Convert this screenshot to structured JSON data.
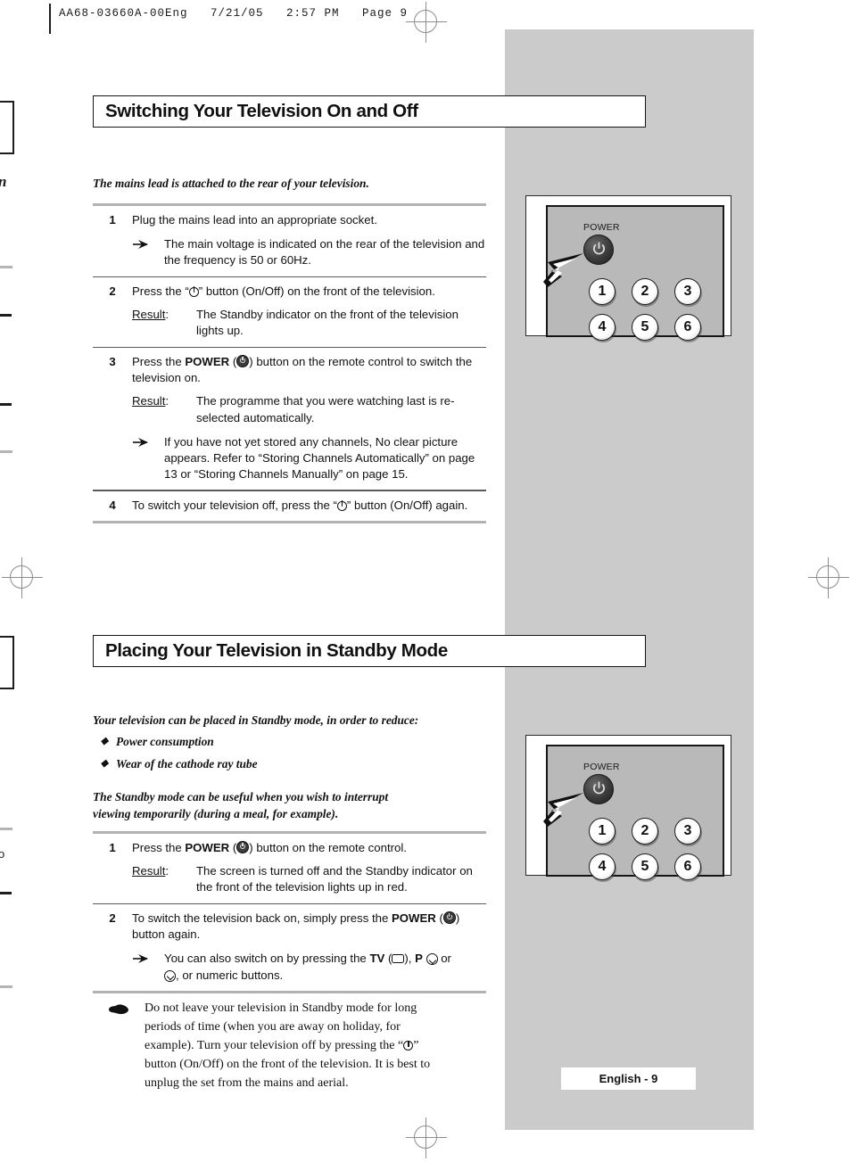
{
  "print_header": {
    "text": "AA68-03660A-00Eng   7/21/05   2:57 PM   Page 9"
  },
  "margin_fragments": {
    "frag_top": "n",
    "frag_bottom": "o"
  },
  "sections": [
    {
      "id": "switching",
      "heading": "Switching Your Television On and Off",
      "intro": "The mains lead is attached to the rear of your television.",
      "steps": [
        {
          "number": "1",
          "text": "Plug the mains lead into an appropriate socket.",
          "note": "The main voltage is indicated on the rear of the television and the frequency is 50 or 60Hz."
        },
        {
          "number": "2",
          "text_before": "Press the “",
          "text_after": "” button (On/Off) on the front of the television.",
          "result_label": "Result",
          "result_colon": ":",
          "result_text": "The Standby indicator on the front of the television lights up."
        },
        {
          "number": "3",
          "text_before": "Press the ",
          "bold_word": "POWER",
          "text_mid": " (",
          "text_after": ") button on the remote control to switch the television on.",
          "result_label": "Result",
          "result_colon": ":",
          "result_text": "The programme that you were watching last is re-selected automatically.",
          "note": "If you have not yet stored any channels, No clear picture appears. Refer to “Storing Channels Automatically” on page 13 or “Storing Channels Manually” on page 15."
        },
        {
          "number": "4",
          "text_before": "To switch your television off, press the “",
          "text_after": "” button (On/Off) again."
        }
      ]
    },
    {
      "id": "standby",
      "heading": "Placing Your Television in Standby Mode",
      "intro": "Your television can be placed in Standby mode, in order to reduce:",
      "bullets": [
        "Power consumption",
        "Wear of the cathode ray tube"
      ],
      "intro2_line1": "The Standby mode can be useful when you wish to interrupt",
      "intro2_line2": "viewing temporarily (during a meal, for example).",
      "steps": [
        {
          "number": "1",
          "text_before": "Press the ",
          "bold_word": "POWER",
          "text_mid": " (",
          "text_after": ") button on the remote control.",
          "result_label": "Result",
          "result_colon": ":",
          "result_text": "The screen is turned off and the Standby indicator on the front of the television lights up in red."
        },
        {
          "number": "2",
          "text_before": "To switch the television back on, simply press the ",
          "bold_word": "POWER",
          "text_mid": " (",
          "text_after": ") button again.",
          "note_a": "You can also switch on by pressing the ",
          "note_tv": "TV",
          "note_b": " (",
          "note_c": "), ",
          "note_p": "P",
          "note_d": " or",
          "note_e": ", or numeric buttons."
        }
      ],
      "tip": {
        "icon": "pointing-hand-icon",
        "line1": "Do not leave your television in Standby mode for long",
        "line2": "periods of time (when you are away on holiday, for",
        "line3_a": "example). Turn your television off by pressing the “",
        "line3_b": "”",
        "line4": "button (On/Off) on the front of the television. It is best to",
        "line5": "unplug the set from the mains and aerial."
      }
    }
  ],
  "illustrations": [
    {
      "id": "remote-top",
      "power_label": "POWER",
      "keys": [
        "1",
        "2",
        "3",
        "4",
        "5",
        "6"
      ]
    },
    {
      "id": "remote-bottom",
      "power_label": "POWER",
      "keys": [
        "1",
        "2",
        "3",
        "4",
        "5",
        "6"
      ]
    }
  ],
  "footer": {
    "page_label": "English - 9"
  },
  "colors": {
    "panel_grey": "#cbcbcb",
    "remote_face": "#b9b9b9",
    "rule_grey": "#b2b2b2",
    "ink": "#111111"
  }
}
